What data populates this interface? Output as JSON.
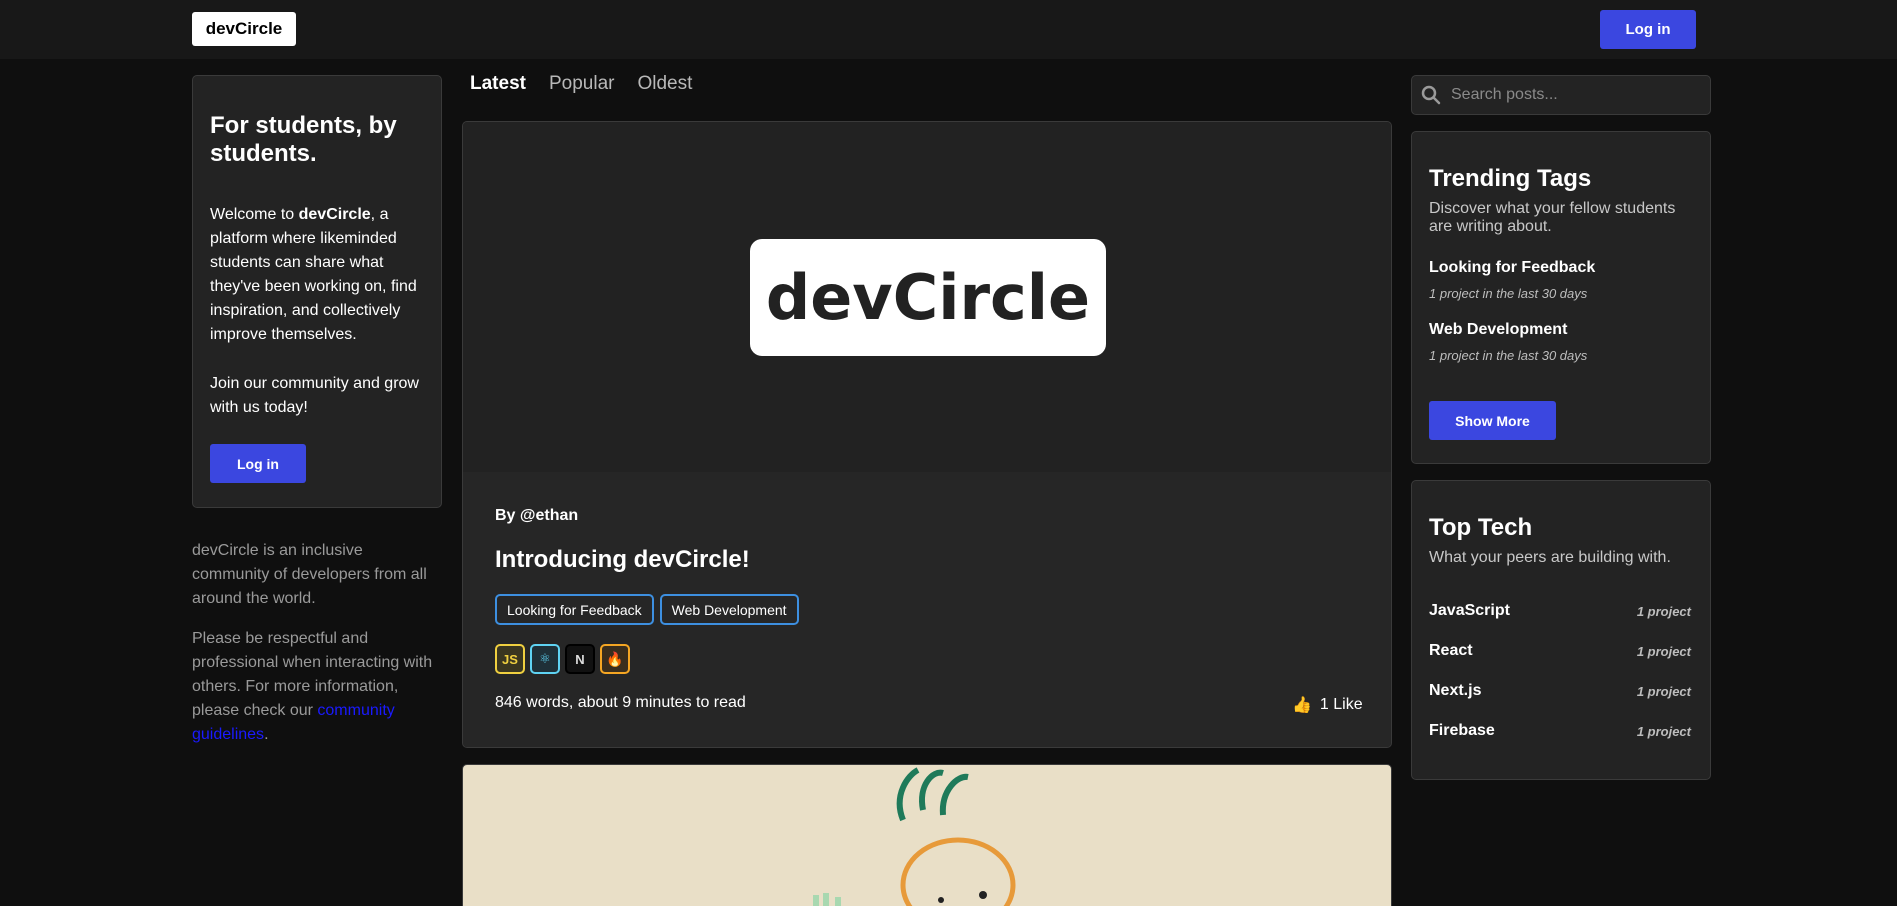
{
  "nav": {
    "brand": "devCircle",
    "login": "Log in"
  },
  "intro": {
    "title": "For students, by students.",
    "welcome_prefix": "Welcome to ",
    "welcome_brand": "devCircle",
    "welcome_suffix": ", a platform where likeminded students can share what they've been working on, find inspiration, and collectively improve themselves.",
    "join": "Join our community and grow with us today!",
    "login": "Log in"
  },
  "about": {
    "p1": "devCircle is an inclusive community of developers from all around the world.",
    "p2_prefix": "Please be respectful and professional when interacting with others. For more information, please check our ",
    "p2_link": "community guidelines",
    "p2_suffix": "."
  },
  "tabs": [
    {
      "label": "Latest",
      "active": true
    },
    {
      "label": "Popular",
      "active": false
    },
    {
      "label": "Oldest",
      "active": false
    }
  ],
  "post": {
    "hero_text": "devCircle",
    "author": "By @ethan",
    "title": "Introducing devCircle!",
    "tags": [
      "Looking for Feedback",
      "Web Development"
    ],
    "techs": [
      {
        "icon": "javascript-icon",
        "glyph": "JS",
        "color": "#f0d040"
      },
      {
        "icon": "react-icon",
        "glyph": "⚛",
        "color": "#5fd3f3"
      },
      {
        "icon": "nextjs-icon",
        "glyph": "N",
        "color": "#000000"
      },
      {
        "icon": "firebase-icon",
        "glyph": "🔥",
        "color": "#f5a623"
      }
    ],
    "wordcount": "846 words, about 9 minutes to read",
    "like_icon": "thumbs-up-icon",
    "likes": "1 Like"
  },
  "search": {
    "placeholder": "Search posts..."
  },
  "trending": {
    "title": "Trending Tags",
    "subtitle": "Discover what your fellow students are writing about.",
    "items": [
      {
        "name": "Looking for Feedback",
        "meta": "1 project in the last 30 days"
      },
      {
        "name": "Web Development",
        "meta": "1 project in the last 30 days"
      }
    ],
    "show_more": "Show More"
  },
  "toptech": {
    "title": "Top Tech",
    "subtitle": "What your peers are building with.",
    "items": [
      {
        "name": "JavaScript",
        "count": "1 project"
      },
      {
        "name": "React",
        "count": "1 project"
      },
      {
        "name": "Next.js",
        "count": "1 project"
      },
      {
        "name": "Firebase",
        "count": "1 project"
      }
    ]
  },
  "colors": {
    "accent": "#3b47e0",
    "tag_border": "#3d8fe0",
    "link": "#1a1aff"
  }
}
